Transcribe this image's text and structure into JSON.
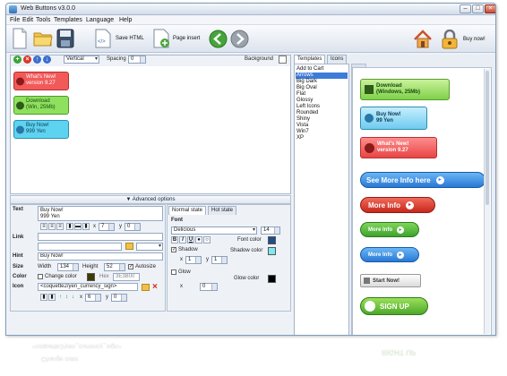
{
  "window": {
    "title": "Web Buttons v3.0.0"
  },
  "menu": [
    "File",
    "Edit",
    "Tools",
    "Templates",
    "Language",
    "Help"
  ],
  "toolbar": {
    "save_html": "Save HTML",
    "page_insert": "Page insert",
    "buy_now": "Buy now!"
  },
  "controls": {
    "orientation": "Vertical",
    "spacing_label": "Spacing",
    "spacing_value": "0",
    "background_label": "Background"
  },
  "canvas_buttons": [
    {
      "line1": "What's New!",
      "line2": "version 9.27"
    },
    {
      "line1": "Download",
      "line2": "(Win, 25Mb)"
    },
    {
      "line1": "Buy Now!",
      "line2": "999 Yen"
    }
  ],
  "advanced": {
    "label": "Advanced options"
  },
  "props": {
    "text_label": "Text",
    "text_value_line1": "Buy Now!",
    "text_value_line2": "999 Yen",
    "text_x_label": "x",
    "text_x": "7",
    "text_y_label": "y",
    "text_y": "0",
    "link_label": "Link",
    "hint_label": "Hint",
    "hint_value": "Buy Now!",
    "size_label": "Size",
    "width_label": "Width",
    "width_value": "134",
    "height_label": "Height",
    "height_value": "52",
    "autosize_label": "Autosize",
    "color_label": "Color",
    "change_color_label": "Change color",
    "hex_label": "Hex",
    "hex_value": "3E3B00",
    "icon_label": "Icon",
    "icon_path": "<coquette2/yen_currency_sign>",
    "icon_x_label": "x",
    "icon_x": "6",
    "icon_y_label": "y",
    "icon_y": "0"
  },
  "state": {
    "tab_normal": "Normal state",
    "tab_hot": "Hot state",
    "font_label": "Font",
    "font_name": "Delicious",
    "font_size": "14",
    "font_color_label": "Font color",
    "shadow_label": "Shadow",
    "shadow_color_label": "Shadow color",
    "shadow_x_label": "x",
    "shadow_x": "1",
    "shadow_y_label": "y",
    "shadow_y": "1",
    "glow_label": "Glow",
    "glow_color_label": "Glow color",
    "glow_x_label": "x",
    "glow_x": "0",
    "colors": {
      "font": "#1f4e8c",
      "shadow": "#7fe8f0",
      "glow": "#000000"
    }
  },
  "templates": {
    "tab_templates": "Templates",
    "tab_icons": "Icons",
    "list": [
      "Add to Cart",
      "Arrows",
      "Big Dark",
      "Big Oval",
      "Flat",
      "Glossy",
      "Left Icons",
      "Rounded",
      "Shiny",
      "Vista",
      "Win7",
      "XP"
    ],
    "selected": "Arrows"
  },
  "preview_buttons": [
    {
      "line1": "Download",
      "line2": "(Windows, 25Mb)"
    },
    {
      "line1": "Buy Now!",
      "line2": "99 Yen"
    },
    {
      "line1": "What's New!",
      "line2": "version 9.27"
    },
    {
      "line1": "See More Info here"
    },
    {
      "line1": "More Info"
    },
    {
      "line1": "More Info"
    },
    {
      "line1": "More Info"
    },
    {
      "line1": "Start Now!"
    },
    {
      "line1": "SIGN UP"
    }
  ],
  "reflection": {
    "line1": "<coquette2/yen_currency_sign>",
    "line2": "Change color",
    "line3": "RIGHT UP"
  }
}
